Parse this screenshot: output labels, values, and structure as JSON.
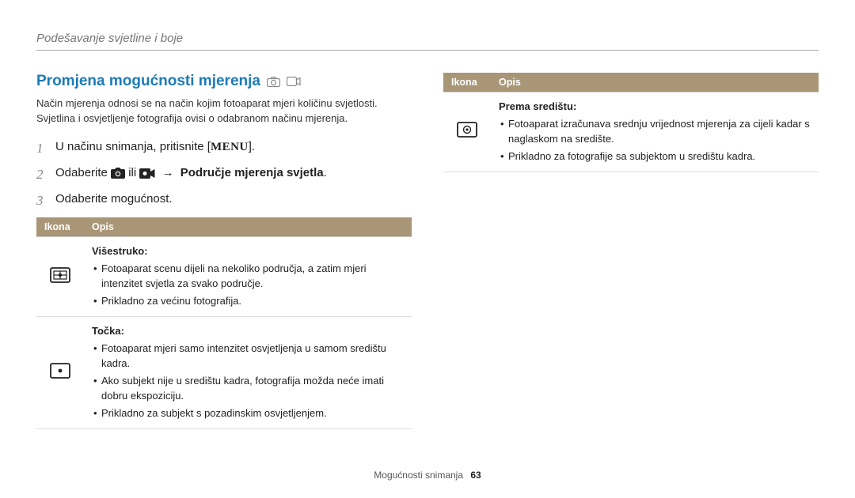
{
  "breadcrumb": "Podešavanje svjetline i boje",
  "heading": "Promjena mogućnosti mjerenja",
  "intro1": "Način mjerenja odnosi se na način kojim fotoaparat mjeri količinu svjetlosti.",
  "intro2": "Svjetlina i osvjetljenje fotografija ovisi o odabranom načinu mjerenja.",
  "steps": {
    "n1": "1",
    "s1_pre": "U načinu snimanja, pritisnite [",
    "s1_btn": "MENU",
    "s1_post": "].",
    "n2": "2",
    "s2_pre": "Odaberite ",
    "s2_or": " ili ",
    "s2_arrow": "→",
    "s2_bold": "Područje mjerenja svjetla",
    "s2_end": ".",
    "n3": "3",
    "s3": "Odaberite mogućnost."
  },
  "table": {
    "col_icon": "Ikona",
    "col_desc": "Opis",
    "row1": {
      "title": "Višestruko",
      "b1": "Fotoaparat scenu dijeli na nekoliko područja, a zatim mjeri intenzitet svjetla za svako područje.",
      "b2": "Prikladno za većinu fotografija."
    },
    "row2": {
      "title": "Točka",
      "b1": "Fotoaparat mjeri samo intenzitet osvjetljenja u samom središtu kadra.",
      "b2": "Ako subjekt nije u središtu kadra, fotografija možda neće imati dobru ekspoziciju.",
      "b3": "Prikladno za subjekt s pozadinskim osvjetljenjem."
    },
    "row3": {
      "title": "Prema središtu",
      "b1": "Fotoaparat izračunava srednju vrijednost mjerenja za cijeli kadar s naglaskom na središte.",
      "b2": "Prikladno za fotografije sa subjektom u središtu kadra."
    }
  },
  "footer": {
    "section": "Mogućnosti snimanja",
    "page": "63"
  }
}
